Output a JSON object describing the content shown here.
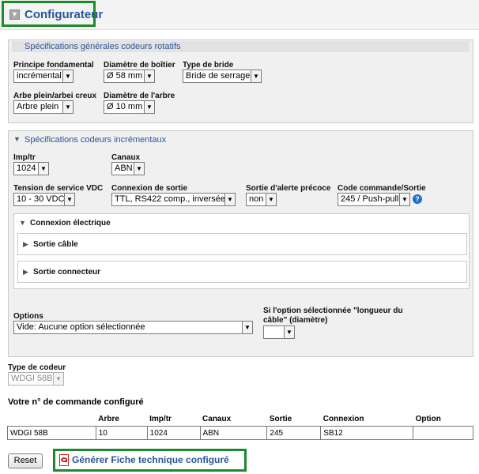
{
  "header": {
    "title": "Configurateur",
    "toggle_glyph": "▾"
  },
  "general": {
    "title": "Spécifications générales codeurs rotatifs",
    "fields": [
      {
        "label": "Principe fondamental",
        "value": "incrémental"
      },
      {
        "label": "Diamètre de boîtier",
        "value": "Ø 58 mm"
      },
      {
        "label": "Type de bride",
        "value": "Bride de serrage"
      },
      {
        "label": "Arbe plein/arbei creux",
        "value": "Arbre plein"
      },
      {
        "label": "Diamètre de l'arbre",
        "value": "Ø 10 mm"
      }
    ]
  },
  "incremental": {
    "title": "Spécifications codeurs incrémentaux",
    "fields": [
      {
        "label": "Imp/tr",
        "value": "1024"
      },
      {
        "label": "Canaux",
        "value": "ABN"
      },
      {
        "label": "Tension de service VDC",
        "value": "10 - 30 VDC"
      },
      {
        "label": "Connexion de sortie",
        "value": "TTL, RS422 comp., inversée"
      },
      {
        "label": "Sortie d'alerte précoce",
        "value": "non"
      },
      {
        "label": "Code commande/Sortie",
        "value": "245 / Push-pull"
      }
    ],
    "electrical": {
      "title": "Connexion électrique",
      "items": [
        "Sortie câble",
        "Sortie connecteur"
      ]
    },
    "options": {
      "label": "Options",
      "value": "Vide: Aucune option sélectionnée"
    },
    "cable_option": {
      "label": "Si l'option sélectionnée \"longueur du câble\" (diamètre)",
      "value": ""
    }
  },
  "encoder_type": {
    "label": "Type de codeur",
    "value": "WDGI 58B"
  },
  "order": {
    "title": "Votre n° de commande configuré",
    "columns": [
      "",
      "Arbre",
      "Imp/tr",
      "Canaux",
      "Sortie",
      "Connexion",
      "Option"
    ],
    "values": [
      "WDGI 58B",
      "10",
      "1024",
      "ABN",
      "245",
      "SB12",
      ""
    ]
  },
  "buttons": {
    "reset": "Reset",
    "generate": "Générer Fiche technique configuré"
  },
  "colors": {
    "link_blue": "#2a5597",
    "highlight_green": "#1c8a2a",
    "pdf_red": "#d21f1f",
    "help_blue": "#1f6fc8"
  }
}
